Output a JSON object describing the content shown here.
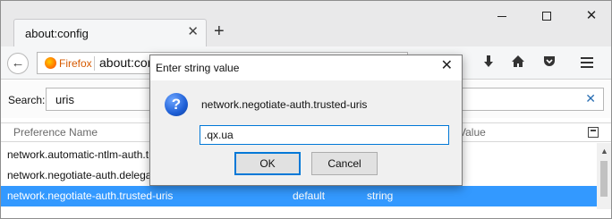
{
  "browser": {
    "tab_title": "about:config",
    "tab_close": "✕",
    "new_tab": "+",
    "identity_label": "Firefox",
    "url": "about:config"
  },
  "search": {
    "label": "Search:",
    "value": "uris",
    "clear": "✕"
  },
  "table": {
    "headers": {
      "preference_name": "Preference Name",
      "value": "Value"
    },
    "rows": [
      {
        "name": "network.automatic-ntlm-auth.trusted-uris",
        "status": "",
        "type": ""
      },
      {
        "name": "network.negotiate-auth.delegation-uris",
        "status": "",
        "type": ""
      },
      {
        "name": "network.negotiate-auth.trusted-uris",
        "status": "default",
        "type": "string",
        "selected": true
      }
    ]
  },
  "dialog": {
    "title": "Enter string value",
    "close": "✕",
    "prompt": "network.negotiate-auth.trusted-uris",
    "input_value": ".qx.ua",
    "ok_label": "OK",
    "cancel_label": "Cancel",
    "icon": "question-icon"
  },
  "colors": {
    "selection": "#3399ff",
    "focus": "#0078d7",
    "brand": "#ff6a00"
  }
}
